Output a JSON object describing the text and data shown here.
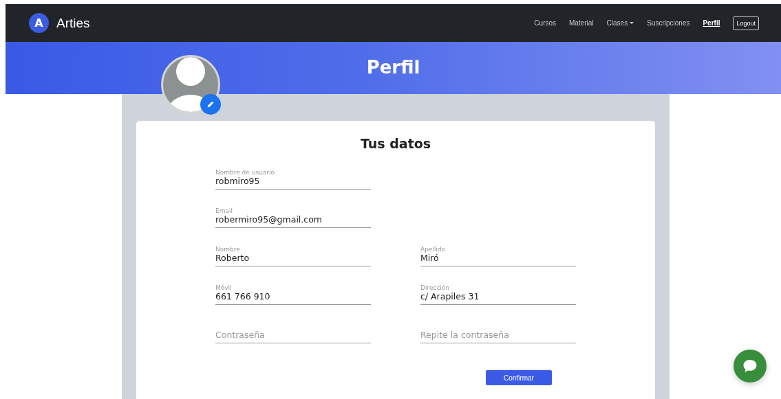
{
  "navbar": {
    "logo_letter": "A",
    "brand": "Arties",
    "items": [
      {
        "label": "Cursos",
        "selected": false,
        "dropdown": false
      },
      {
        "label": "Material",
        "selected": false,
        "dropdown": false
      },
      {
        "label": "Clases",
        "selected": false,
        "dropdown": true
      },
      {
        "label": "Suscripciones",
        "selected": false,
        "dropdown": false
      },
      {
        "label": "Perfil",
        "selected": true,
        "dropdown": false
      }
    ],
    "logout": "Logout"
  },
  "banner": {
    "title": "Perfil"
  },
  "form": {
    "title": "Tus datos",
    "rows": [
      [
        {
          "label": "Nombre de usuario",
          "value": "robmiro95"
        }
      ],
      [
        {
          "label": "Email",
          "value": "robermiro95@gmail.com"
        }
      ],
      [
        {
          "label": "Nombre",
          "value": "Roberto"
        },
        {
          "label": "Apellido",
          "value": "Miró"
        }
      ],
      [
        {
          "label": "Móvil",
          "value": "661 766 910"
        },
        {
          "label": "Dirección",
          "value": "c/ Arapiles 31"
        }
      ],
      [
        {
          "placeholder": "Contraseña"
        },
        {
          "placeholder": "Repite la contraseña"
        }
      ]
    ],
    "submit": "Confirmar"
  }
}
